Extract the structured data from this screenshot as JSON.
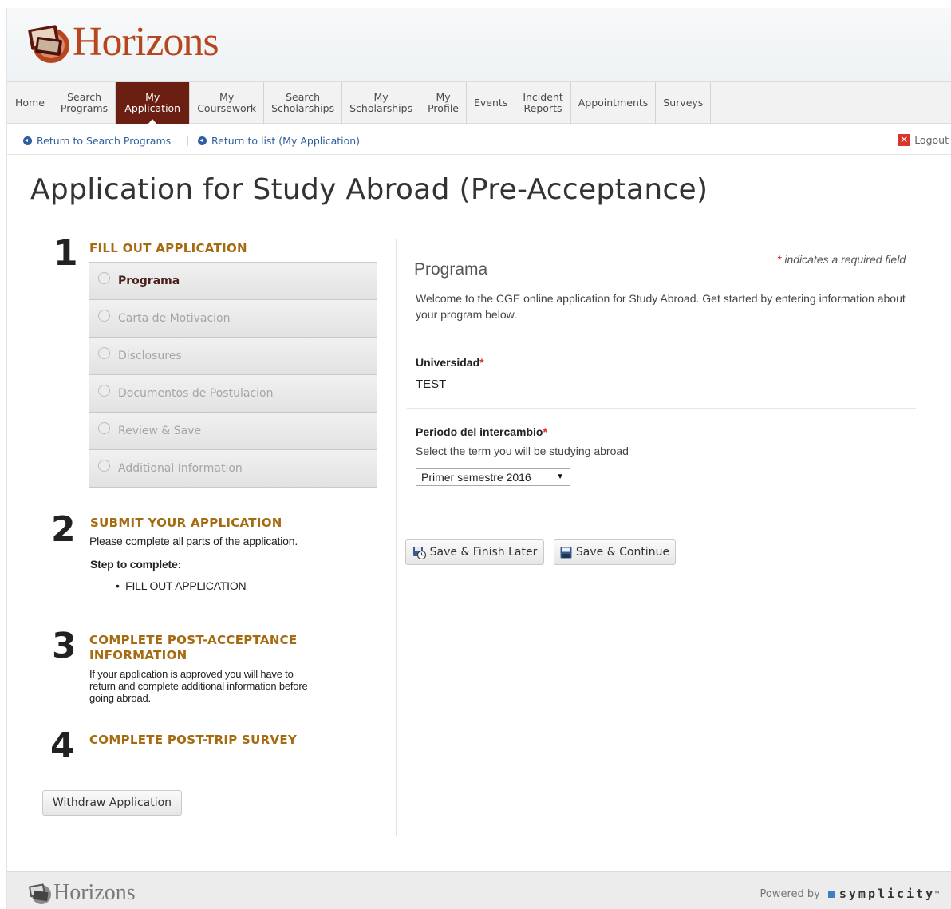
{
  "brand": {
    "name": "Horizons"
  },
  "nav": {
    "items": [
      {
        "label": "Home"
      },
      {
        "label": "Search\nPrograms"
      },
      {
        "label": "My\nApplication",
        "active": true
      },
      {
        "label": "My\nCoursework"
      },
      {
        "label": "Search\nScholarships"
      },
      {
        "label": "My\nScholarships"
      },
      {
        "label": "My\nProfile"
      },
      {
        "label": "Events"
      },
      {
        "label": "Incident\nReports"
      },
      {
        "label": "Appointments"
      },
      {
        "label": "Surveys"
      }
    ]
  },
  "subnav": {
    "return_search": "Return to Search Programs",
    "separator": "|",
    "return_list": "Return to list (My Application)",
    "logout": "Logout"
  },
  "page": {
    "title": "Application for Study Abroad (Pre-Acceptance)"
  },
  "steps": {
    "s1": {
      "num": "1",
      "title": "FILL OUT APPLICATION",
      "items": [
        "Programa",
        "Carta de Motivacion",
        "Disclosures",
        "Documentos de Postulacion",
        "Review & Save",
        "Additional Information"
      ]
    },
    "s2": {
      "num": "2",
      "title": "SUBMIT YOUR APPLICATION",
      "desc": "Please complete all parts of the application.",
      "step_label": "Step to complete:",
      "bullet": "FILL OUT APPLICATION"
    },
    "s3": {
      "num": "3",
      "title_line1": "COMPLETE POST-ACCEPTANCE",
      "title_line2": "INFORMATION",
      "desc_line1": "If your application is approved you will have to",
      "desc_line2": "return and complete additional information before",
      "desc_line3": "going abroad."
    },
    "s4": {
      "num": "4",
      "title": "COMPLETE POST-TRIP SURVEY"
    },
    "withdraw": "Withdraw Application"
  },
  "form": {
    "required_star": "*",
    "required_note": "indicates a required field",
    "section_title": "Programa",
    "intro": "Welcome to the CGE online application for Study Abroad. Get started by entering information about your program below.",
    "universidad": {
      "label": "Universidad",
      "value": "TEST"
    },
    "periodo": {
      "label": "Periodo del intercambio",
      "help": "Select the term you will be studying abroad",
      "selected": "Primer semestre 2016"
    },
    "save_later": "Save & Finish Later",
    "save_continue": "Save & Continue"
  },
  "footer": {
    "brand": "Horizons",
    "powered": "Powered by",
    "vendor": "symplicity",
    "tm": "™"
  },
  "colors": {
    "accent": "#6a1f12",
    "step_title": "#a46b11",
    "link": "#2f5f9e",
    "logo": "#b7451e"
  }
}
